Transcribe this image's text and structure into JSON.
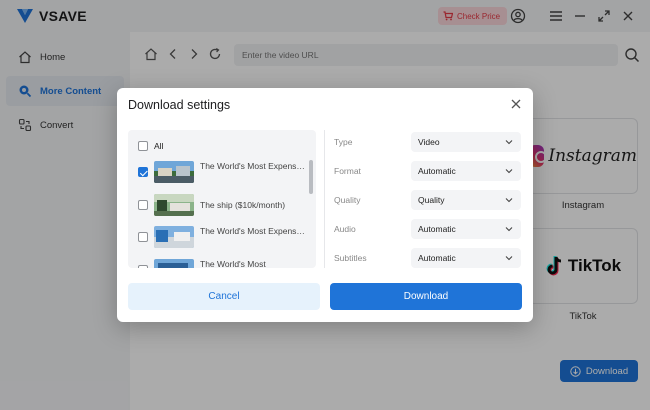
{
  "app": {
    "name": "VSAVE",
    "check_price_label": "Check Price"
  },
  "sidebar": {
    "items": [
      {
        "label": "Home",
        "icon": "home-icon",
        "active": false
      },
      {
        "label": "More Content",
        "icon": "search-icon",
        "active": true
      },
      {
        "label": "Convert",
        "icon": "convert-icon",
        "active": false
      }
    ]
  },
  "browser": {
    "url_placeholder": "Enter the video URL"
  },
  "platforms": [
    {
      "name": "Instagram"
    },
    {
      "name": "TikTok"
    }
  ],
  "main_download_label": "Download",
  "dialog": {
    "title": "Download settings",
    "select_all_label": "All",
    "videos": [
      {
        "title": "The World's Most Expensive Gym Membe...",
        "checked": true
      },
      {
        "title": "The ship ($10k/month)",
        "checked": false
      },
      {
        "title": "The World's Most Expensive Gym Membe...",
        "checked": false
      },
      {
        "title": "The World's Most",
        "checked": false
      }
    ],
    "options": [
      {
        "label": "Type",
        "value": "Video"
      },
      {
        "label": "Format",
        "value": "Automatic"
      },
      {
        "label": "Quality",
        "value": "Quality"
      },
      {
        "label": "Audio",
        "value": "Automatic"
      },
      {
        "label": "Subtitles",
        "value": "Automatic"
      }
    ],
    "cancel_label": "Cancel",
    "download_label": "Download"
  },
  "colors": {
    "accent": "#1f74d8",
    "price_text": "#e63946"
  }
}
